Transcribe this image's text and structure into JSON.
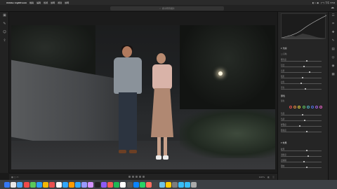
{
  "menubar": {
    "app": "Adobe Lightroom",
    "items": [
      "檔案",
      "編輯",
      "檢視",
      "說明",
      "視窗",
      "說明"
    ],
    "right": "(一) 下午 3:54"
  },
  "toolbar": {
    "search_placeholder": "搜尋所有相片"
  },
  "left_rail_icons": [
    "library-icon",
    "edit-icon",
    "people-icon",
    "share-icon"
  ],
  "right_rail_icons": [
    "sliders-icon",
    "crop-icon",
    "healing-icon",
    "brush-icon",
    "gradient-icon",
    "radial-icon",
    "redeye-icon",
    "preset-icon"
  ],
  "panel": {
    "sections": [
      {
        "title": "▾ 光線",
        "top": 0
      },
      {
        "title": "顏色",
        "top": 0
      },
      {
        "title": "▾ 效果",
        "top": 0
      }
    ],
    "light_rows": [
      "曝光度",
      "對比",
      "亮部",
      "陰影",
      "白色",
      "黑色"
    ],
    "color_label": "混色",
    "color_rows": [
      "色溫",
      "色調",
      "鮮豔度",
      "飽和度"
    ],
    "effect_rows": [
      "紋理",
      "清晰度",
      "去朦朧",
      "暈映"
    ]
  },
  "filmstrip": {
    "zoom": "100%"
  },
  "accent": "#4a90d9"
}
